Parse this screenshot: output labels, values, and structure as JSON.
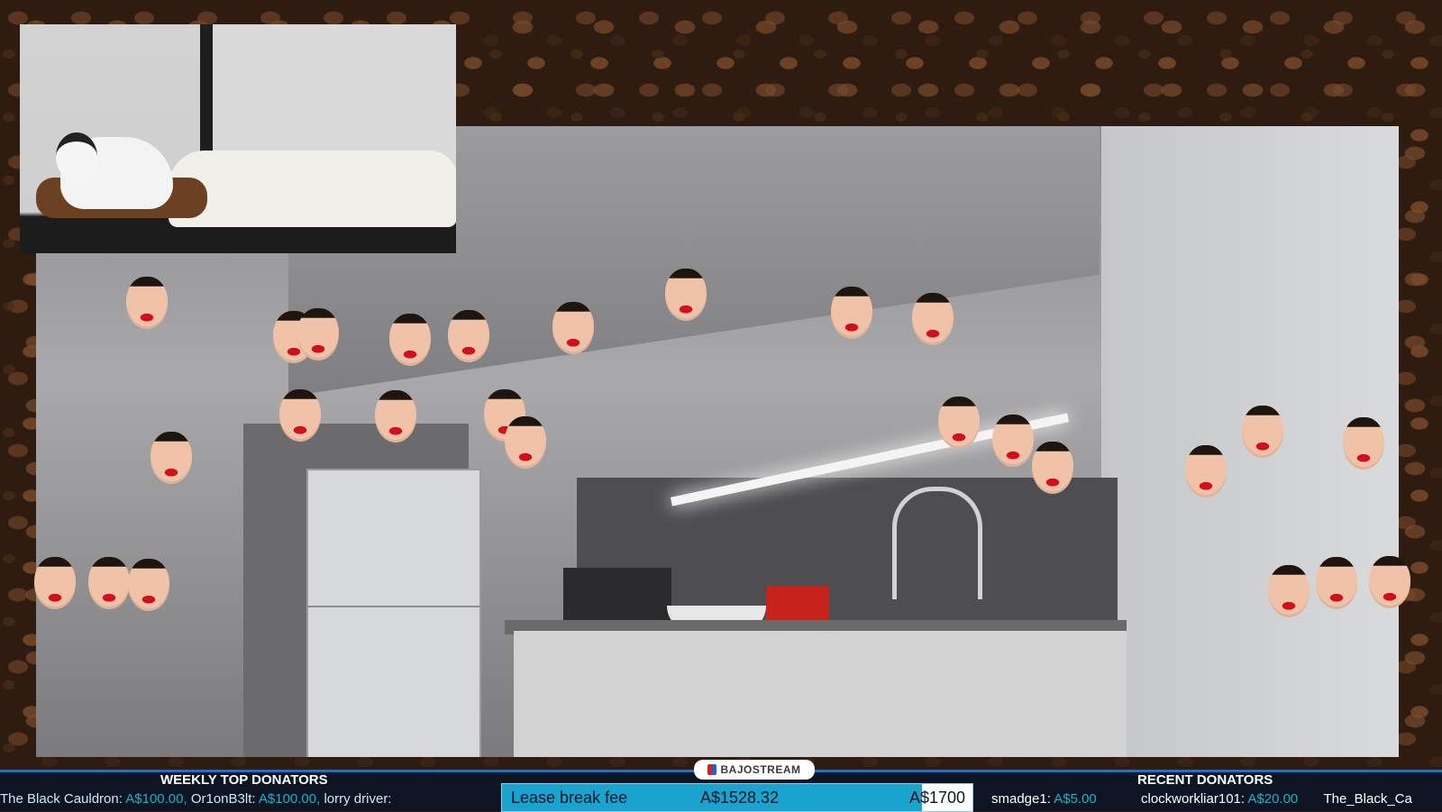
{
  "overlay": {
    "brand": "BAJOSTREAM",
    "weekly_label": "WEEKLY TOP DONATORS",
    "recent_label": "RECENT DONATORS",
    "weekly_ticker": [
      {
        "name": "The  Black  Cauldron:",
        "amount": "A$100.00,"
      },
      {
        "name": "Or1onB3lt:",
        "amount": "A$100.00,"
      },
      {
        "name": "lorry  driver:",
        "amount": ""
      }
    ],
    "goal": {
      "label": "Lease break fee",
      "current": "A$1528.32",
      "target": "A$1700",
      "progress": 0.899
    },
    "recent_left": {
      "name": "smadge1:",
      "amount": "A$5.00"
    },
    "recent_ticker": [
      {
        "name": "clockworkliar101:",
        "amount": "A$20.00"
      },
      {
        "name": "The_Black_Ca",
        "amount": ""
      }
    ]
  },
  "colors": {
    "accent": "#1aa3cf",
    "lips": "#d10f1d",
    "bar": "#0d1524"
  }
}
